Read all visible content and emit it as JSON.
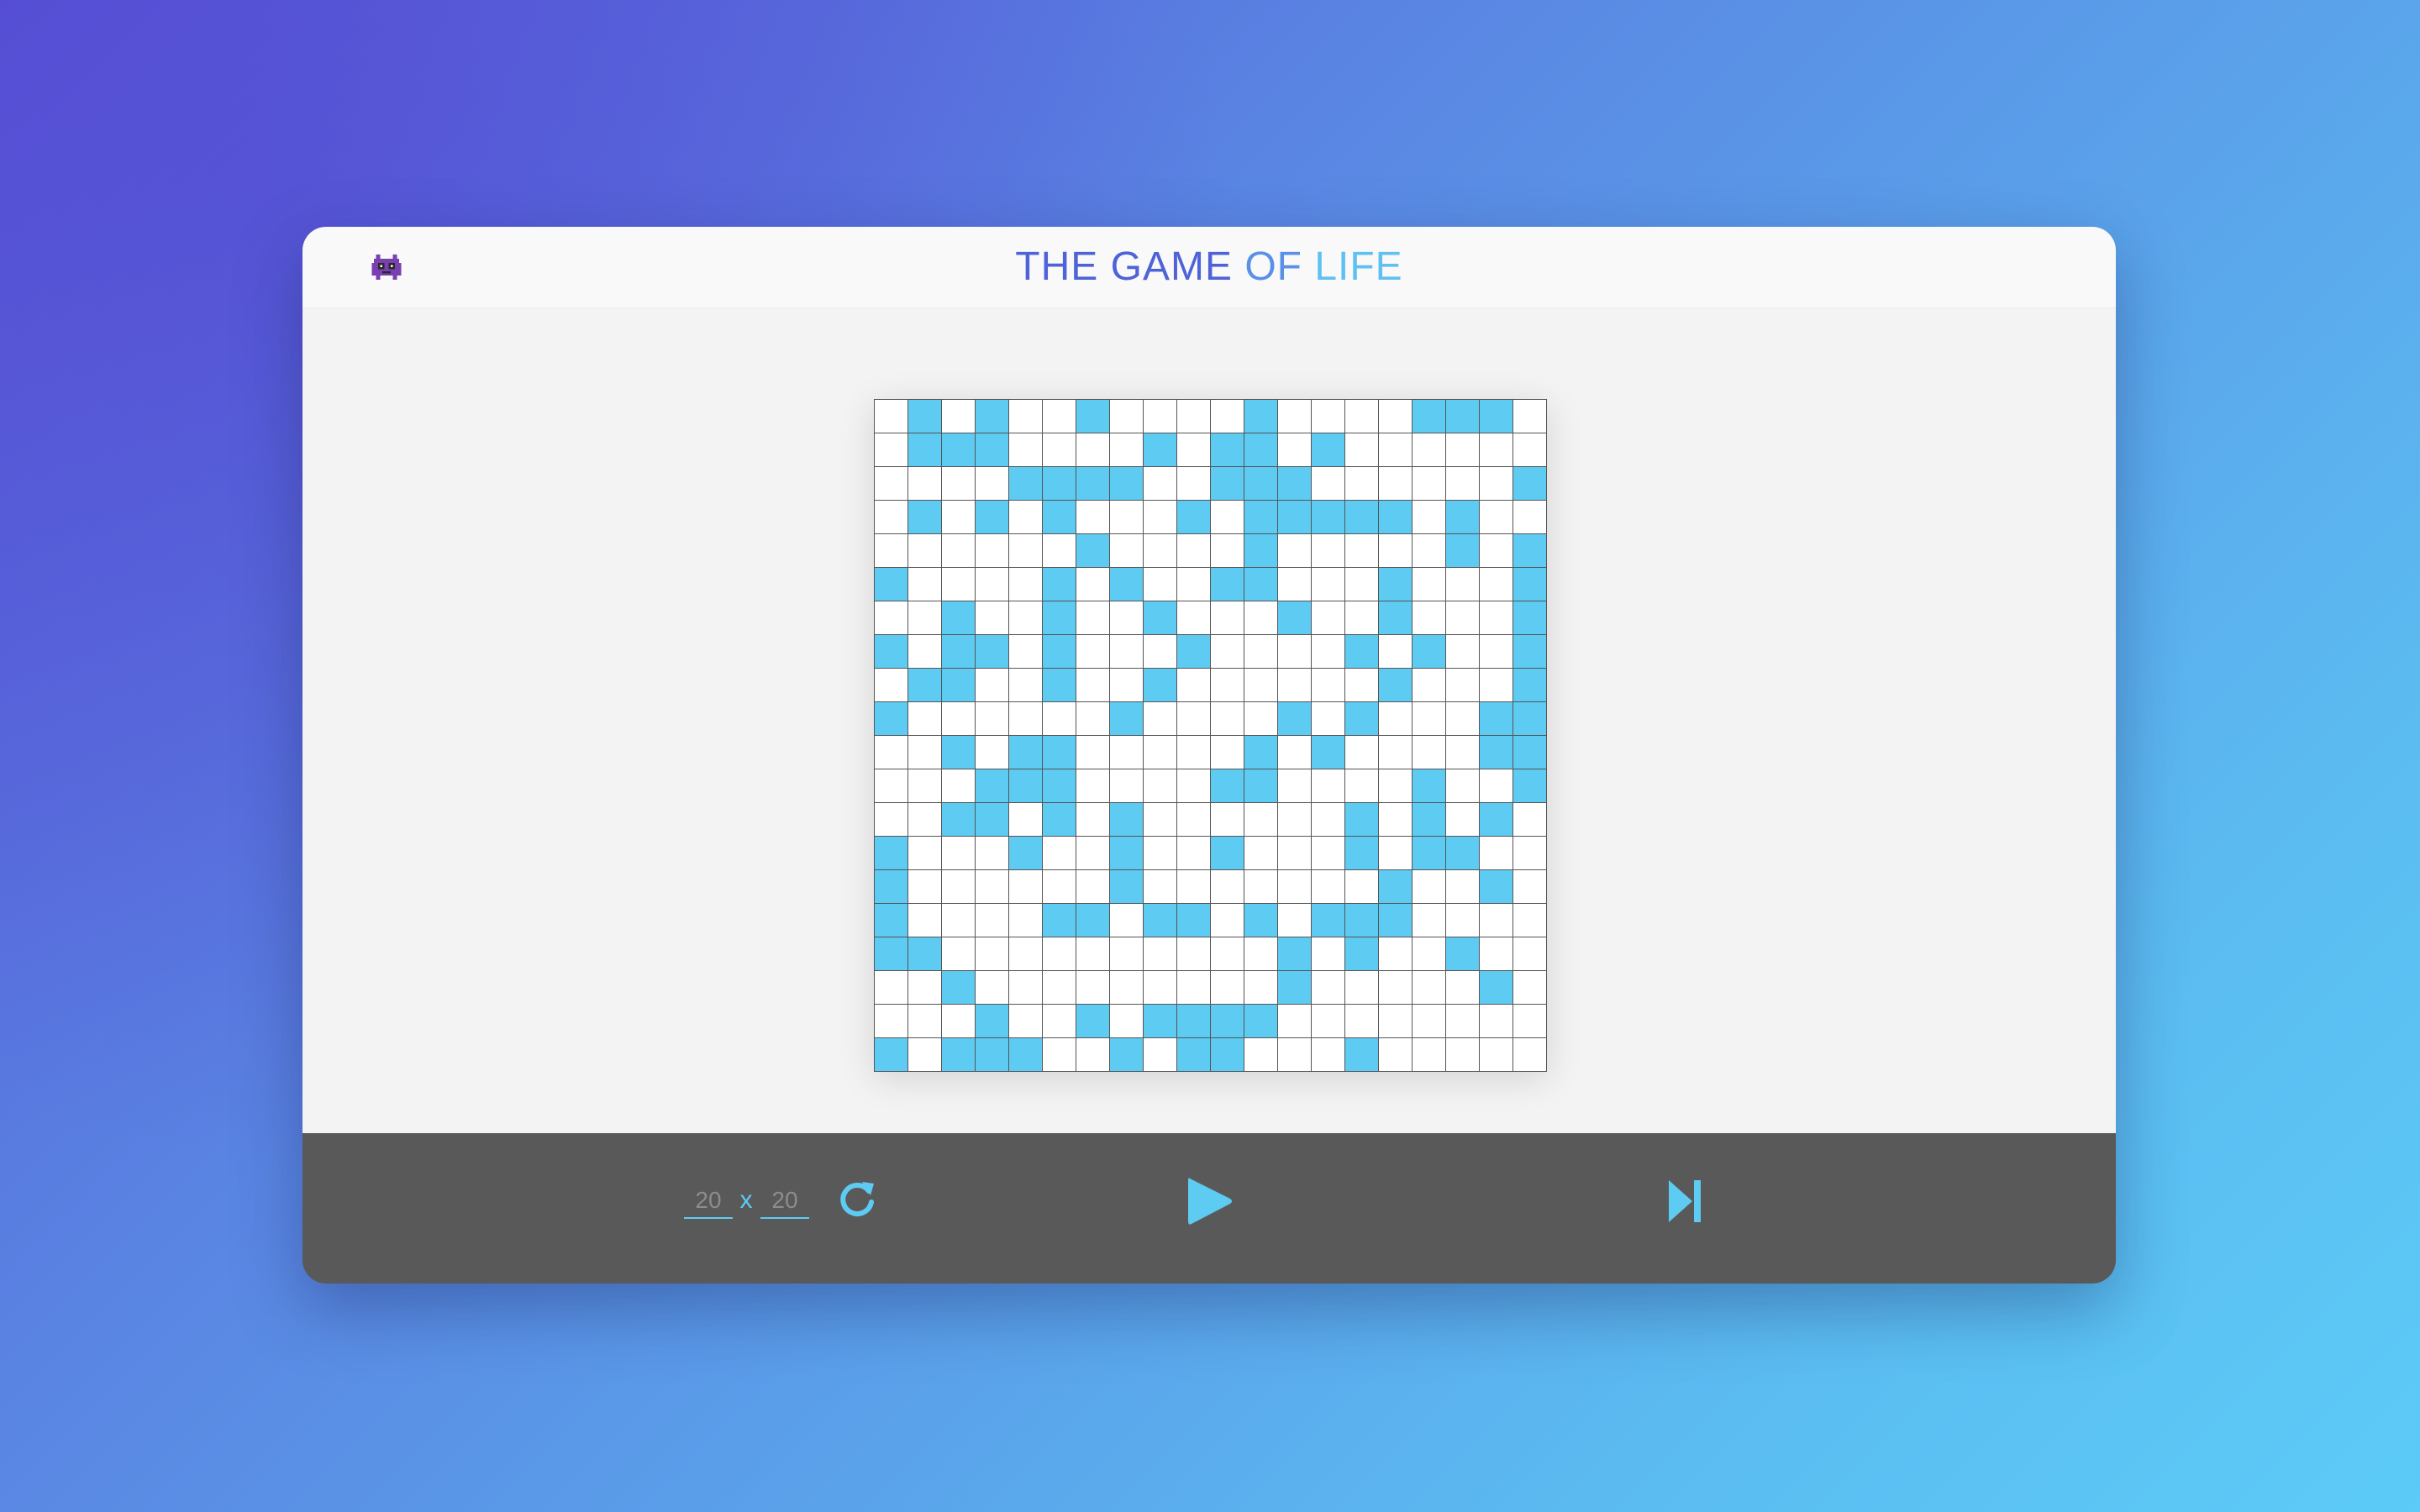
{
  "app": {
    "title_parts": [
      "THE GAME",
      " OF ",
      "LIFE"
    ],
    "title_colors": [
      "#4f63d8",
      "#5a90e6",
      "#5fc0f2"
    ],
    "icon": "alien-monster-icon"
  },
  "board": {
    "rows": 20,
    "cols": 20,
    "alive_color": "#5ecbf3",
    "dead_color": "#ffffff",
    "cells": [
      "01010010000100001110",
      "01110000101101000000",
      "00001111001110000001",
      "01010100010111110100",
      "00000010000100000101",
      "10000101001100010001",
      "00100100100010010001",
      "10110100010000101001",
      "01100100100000010001",
      "10000001000010100011",
      "00101100000101000011",
      "00011100001100001001",
      "00110101000000101010",
      "10001001001000101100",
      "10000001000000010010",
      "10000110110101110000",
      "11000000000010100100",
      "00100000000010000010",
      "00010010111100000000",
      "10111001011000100000"
    ]
  },
  "controls": {
    "rows_placeholder": "20",
    "cols_placeholder": "20",
    "separator": "x",
    "reset_icon": "refresh-icon",
    "play_icon": "play-icon",
    "step_icon": "skip-next-icon",
    "accent": "#5ecbf3"
  }
}
